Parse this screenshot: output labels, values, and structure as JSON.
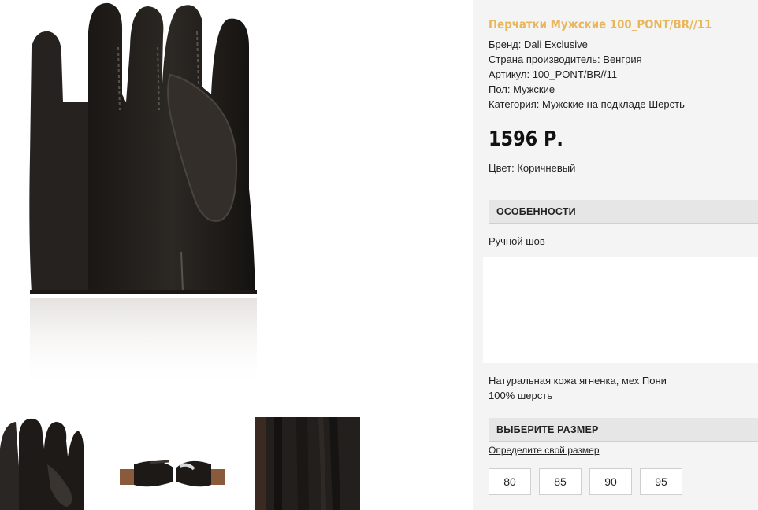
{
  "product": {
    "title": "Перчатки Мужские 100_PONT/BR//11",
    "attributes": [
      "Бренд: Dali Exclusive",
      "Страна производитель: Венгрия",
      "Артикул: 100_PONT/BR//11",
      "Пол: Мужские",
      "Категория: Мужские на подкладе Шерсть"
    ],
    "price": "1596 Р.",
    "color": "Цвет: Коричневый"
  },
  "features": {
    "heading": "ОСОБЕННОСТИ",
    "text": "Ручной шов",
    "material_lines": [
      "Натуральная кожа ягненка, мех Пони",
      "100% шерсть"
    ]
  },
  "size": {
    "heading": "ВЫБЕРИТЕ РАЗМЕР",
    "link": "Определите свой размер",
    "options": [
      "80",
      "85",
      "90",
      "95"
    ]
  },
  "colors": {
    "title": "#e8b65b",
    "panel": "#f4f4f4",
    "section_header": "#e6e6e6"
  }
}
